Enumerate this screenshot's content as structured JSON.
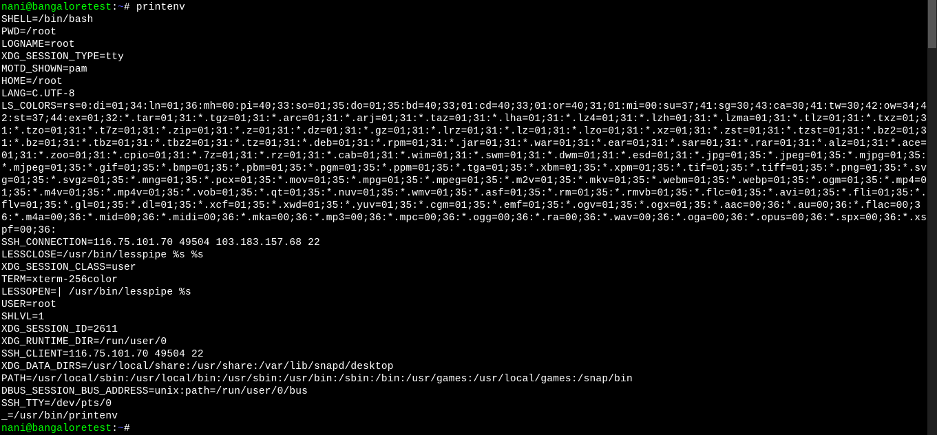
{
  "prompt1": {
    "user": "nani",
    "at": "@",
    "host": "bangaloretest",
    "colon": ":",
    "path": "~",
    "hash": "# ",
    "command": "printenv"
  },
  "env": {
    "SHELL": "SHELL=/bin/bash",
    "PWD": "PWD=/root",
    "LOGNAME": "LOGNAME=root",
    "XDG_SESSION_TYPE": "XDG_SESSION_TYPE=tty",
    "MOTD_SHOWN": "MOTD_SHOWN=pam",
    "HOME": "HOME=/root",
    "LANG": "LANG=C.UTF-8",
    "LS_COLORS": "LS_COLORS=rs=0:di=01;34:ln=01;36:mh=00:pi=40;33:so=01;35:do=01;35:bd=40;33;01:cd=40;33;01:or=40;31;01:mi=00:su=37;41:sg=30;43:ca=30;41:tw=30;42:ow=34;42:st=37;44:ex=01;32:*.tar=01;31:*.tgz=01;31:*.arc=01;31:*.arj=01;31:*.taz=01;31:*.lha=01;31:*.lz4=01;31:*.lzh=01;31:*.lzma=01;31:*.tlz=01;31:*.txz=01;31:*.tzo=01;31:*.t7z=01;31:*.zip=01;31:*.z=01;31:*.dz=01;31:*.gz=01;31:*.lrz=01;31:*.lz=01;31:*.lzo=01;31:*.xz=01;31:*.zst=01;31:*.tzst=01;31:*.bz2=01;31:*.bz=01;31:*.tbz=01;31:*.tbz2=01;31:*.tz=01;31:*.deb=01;31:*.rpm=01;31:*.jar=01;31:*.war=01;31:*.ear=01;31:*.sar=01;31:*.rar=01;31:*.alz=01;31:*.ace=01;31:*.zoo=01;31:*.cpio=01;31:*.7z=01;31:*.rz=01;31:*.cab=01;31:*.wim=01;31:*.swm=01;31:*.dwm=01;31:*.esd=01;31:*.jpg=01;35:*.jpeg=01;35:*.mjpg=01;35:*.mjpeg=01;35:*.gif=01;35:*.bmp=01;35:*.pbm=01;35:*.pgm=01;35:*.ppm=01;35:*.tga=01;35:*.xbm=01;35:*.xpm=01;35:*.tif=01;35:*.tiff=01;35:*.png=01;35:*.svg=01;35:*.svgz=01;35:*.mng=01;35:*.pcx=01;35:*.mov=01;35:*.mpg=01;35:*.mpeg=01;35:*.m2v=01;35:*.mkv=01;35:*.webm=01;35:*.webp=01;35:*.ogm=01;35:*.mp4=01;35:*.m4v=01;35:*.mp4v=01;35:*.vob=01;35:*.qt=01;35:*.nuv=01;35:*.wmv=01;35:*.asf=01;35:*.rm=01;35:*.rmvb=01;35:*.flc=01;35:*.avi=01;35:*.fli=01;35:*.flv=01;35:*.gl=01;35:*.dl=01;35:*.xcf=01;35:*.xwd=01;35:*.yuv=01;35:*.cgm=01;35:*.emf=01;35:*.ogv=01;35:*.ogx=01;35:*.aac=00;36:*.au=00;36:*.flac=00;36:*.m4a=00;36:*.mid=00;36:*.midi=00;36:*.mka=00;36:*.mp3=00;36:*.mpc=00;36:*.ogg=00;36:*.ra=00;36:*.wav=00;36:*.oga=00;36:*.opus=00;36:*.spx=00;36:*.xspf=00;36:",
    "SSH_CONNECTION": "SSH_CONNECTION=116.75.101.70 49504 103.183.157.68 22",
    "LESSCLOSE": "LESSCLOSE=/usr/bin/lesspipe %s %s",
    "XDG_SESSION_CLASS": "XDG_SESSION_CLASS=user",
    "TERM": "TERM=xterm-256color",
    "LESSOPEN": "LESSOPEN=| /usr/bin/lesspipe %s",
    "USER": "USER=root",
    "SHLVL": "SHLVL=1",
    "XDG_SESSION_ID": "XDG_SESSION_ID=2611",
    "XDG_RUNTIME_DIR": "XDG_RUNTIME_DIR=/run/user/0",
    "SSH_CLIENT": "SSH_CLIENT=116.75.101.70 49504 22",
    "XDG_DATA_DIRS": "XDG_DATA_DIRS=/usr/local/share:/usr/share:/var/lib/snapd/desktop",
    "PATH": "PATH=/usr/local/sbin:/usr/local/bin:/usr/sbin:/usr/bin:/sbin:/bin:/usr/games:/usr/local/games:/snap/bin",
    "DBUS_SESSION_BUS_ADDRESS": "DBUS_SESSION_BUS_ADDRESS=unix:path=/run/user/0/bus",
    "SSH_TTY": "SSH_TTY=/dev/pts/0",
    "UNDERSCORE": "_=/usr/bin/printenv"
  },
  "prompt2": {
    "user": "nani",
    "at": "@",
    "host": "bangaloretest",
    "colon": ":",
    "path": "~",
    "hash": "#"
  }
}
